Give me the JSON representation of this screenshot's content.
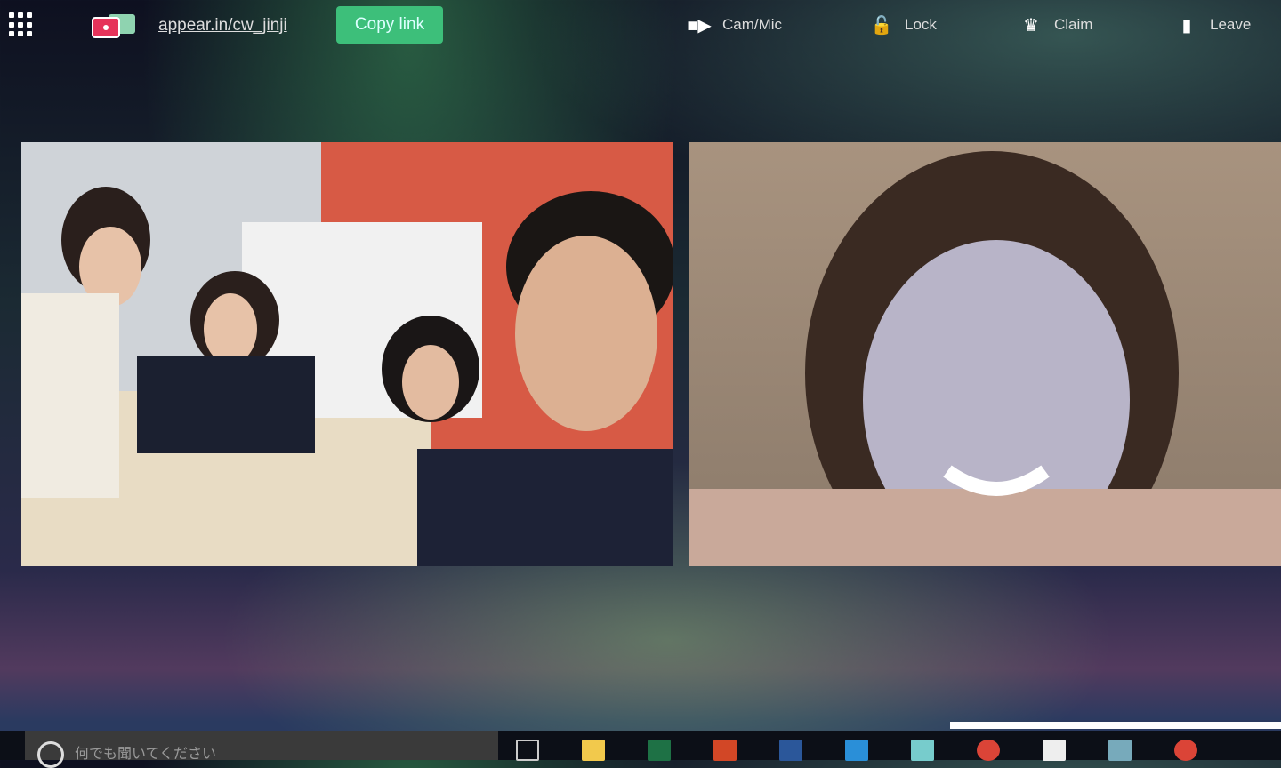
{
  "header": {
    "room_url": "appear.in/cw_jinji",
    "copy_label": "Copy link",
    "actions": [
      {
        "label": "Cam/Mic",
        "icon": "camera-icon"
      },
      {
        "label": "Lock",
        "icon": "lock-icon"
      },
      {
        "label": "Claim",
        "icon": "crown-icon"
      },
      {
        "label": "Leave",
        "icon": "door-icon"
      }
    ]
  },
  "taskbar": {
    "search_placeholder": "何でも聞いてください",
    "apps": [
      "task-view",
      "file-explorer",
      "excel",
      "powerpoint",
      "word",
      "app",
      "store",
      "chrome",
      "app2",
      "app3",
      "chrome2"
    ]
  }
}
